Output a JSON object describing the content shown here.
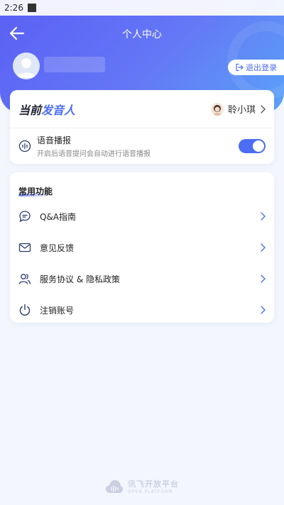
{
  "status_bar": {
    "time": "2:26"
  },
  "header": {
    "title": "个人中心",
    "logout_label": "退出登录"
  },
  "speaker": {
    "title_prefix": "当前",
    "title_accent": "发音人",
    "current_name": "聆小琪"
  },
  "voice_broadcast": {
    "label": "语音播报",
    "description": "开启后语音提问会自动进行语音播报",
    "enabled": true
  },
  "functions": {
    "title": "常用功能",
    "items": [
      {
        "label": "Q&A指南",
        "icon": "chat-bubble-icon"
      },
      {
        "label": "意见反馈",
        "icon": "mail-icon"
      },
      {
        "label": "服务协议 & 隐私政策",
        "icon": "users-icon"
      },
      {
        "label": "注销账号",
        "icon": "power-icon"
      }
    ]
  },
  "footer": {
    "brand": "讯飞开放平台",
    "sub": "OPEN PLATFORM"
  },
  "colors": {
    "accent": "#4b6ef5",
    "header_start": "#5a5ff4",
    "header_end": "#5aa3f7"
  }
}
